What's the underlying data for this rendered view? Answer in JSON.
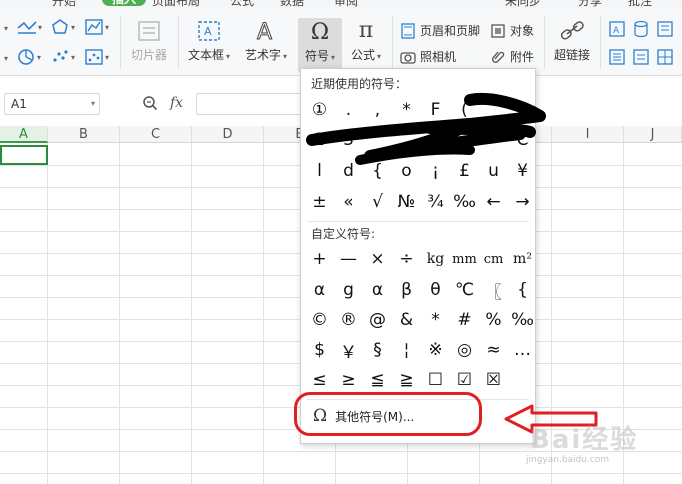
{
  "tabs": [
    {
      "label": "开始",
      "active": false
    },
    {
      "label": "插入",
      "active": true
    },
    {
      "label": "页面布局",
      "active": false
    },
    {
      "label": "公式",
      "active": false
    },
    {
      "label": "数据",
      "active": false
    },
    {
      "label": "审阅",
      "active": false
    },
    {
      "label": "未同步",
      "active": false
    },
    {
      "label": "分享",
      "active": false
    },
    {
      "label": "批注",
      "active": false
    }
  ],
  "ribbon": {
    "slicer": "切片器",
    "textbox": "文本框",
    "wordart": "艺术字",
    "symbol": "符号",
    "formula": "公式",
    "header_footer": "页眉和页脚",
    "object": "对象",
    "camera": "照相机",
    "attachment": "附件",
    "hyperlink": "超链接"
  },
  "formula_bar": {
    "name_box": "A1",
    "fx": "fx"
  },
  "columns": [
    "A",
    "B",
    "C",
    "D",
    "E",
    "F",
    "G",
    "H",
    "I",
    "J"
  ],
  "symbol_menu": {
    "recent_title": "近期使用的符号：",
    "recent_rows": [
      [
        "①",
        ".",
        ",",
        "*",
        "F",
        "(",
        "",
        ""
      ],
      [
        "2",
        "3",
        "",
        "",
        "",
        "",
        "",
        "C"
      ],
      [
        "l",
        "d",
        "{",
        "o",
        "¡",
        "£",
        "u",
        "¥"
      ],
      [
        "±",
        "«",
        "√",
        "№",
        "¾",
        "‰",
        "←",
        "→"
      ]
    ],
    "custom_title": "自定义符号:",
    "custom_rows": [
      [
        "+",
        "—",
        "×",
        "÷",
        "kg",
        "mm",
        "cm",
        "m²"
      ],
      [
        "α",
        "g",
        "α",
        "β",
        "θ",
        "℃",
        "〖",
        "{"
      ],
      [
        "©",
        "®",
        "@",
        "&",
        "*",
        "#",
        "%",
        "‰"
      ],
      [
        "$",
        "￥",
        "§",
        "¦",
        "※",
        "◎",
        "≈",
        "…"
      ],
      [
        "≤",
        "≥",
        "≦",
        "≧",
        "☐",
        "☑",
        "☒",
        ""
      ]
    ],
    "more_label": "其他符号(M)..."
  },
  "watermark": {
    "text": "Bai经验",
    "sub": "jingyan.baidu.com"
  },
  "colors": {
    "accent_green": "#2e8b3d",
    "annotation_red": "#e02020"
  }
}
